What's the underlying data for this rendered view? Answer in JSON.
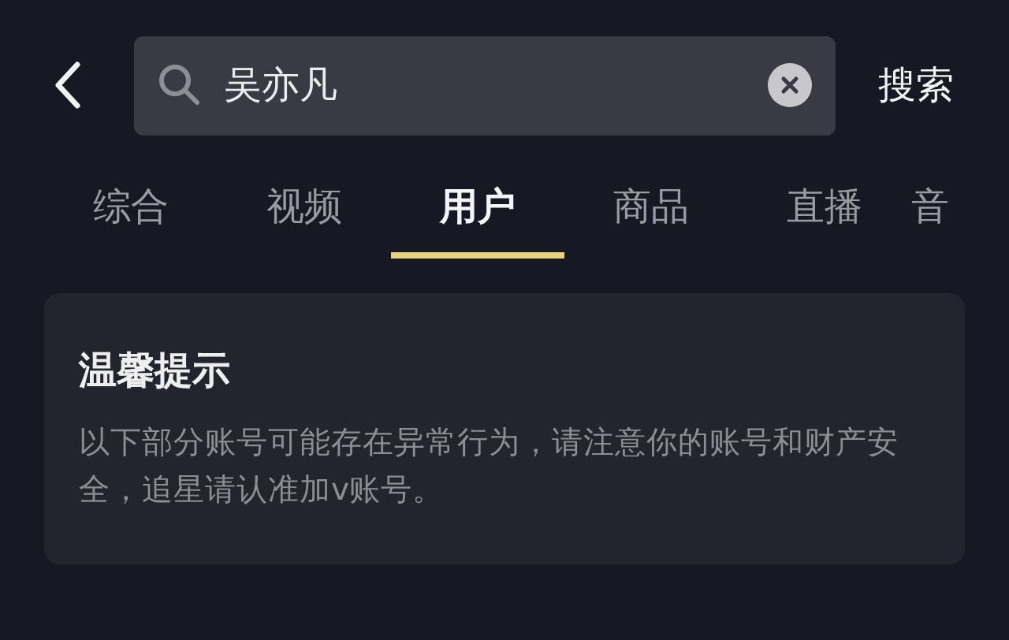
{
  "search": {
    "value": "吴亦凡",
    "button": "搜索"
  },
  "tabs": [
    {
      "label": "综合",
      "selected": false
    },
    {
      "label": "视频",
      "selected": false
    },
    {
      "label": "用户",
      "selected": true
    },
    {
      "label": "商品",
      "selected": false
    },
    {
      "label": "直播",
      "selected": false
    },
    {
      "label": "音",
      "selected": false
    }
  ],
  "notice": {
    "title": "温馨提示",
    "body": "以下部分账号可能存在异常行为，请注意你的账号和财产安全，追星请认准加v账号。"
  }
}
